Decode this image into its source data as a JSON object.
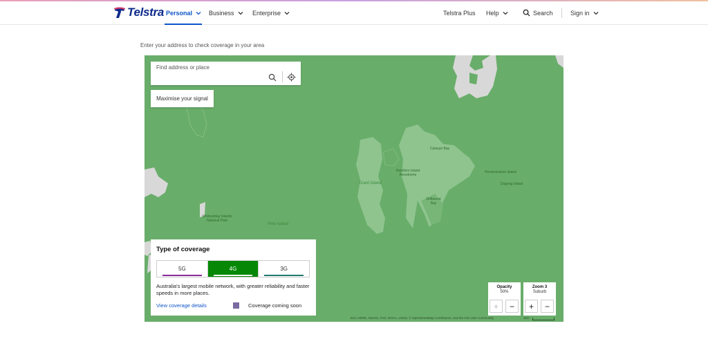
{
  "header": {
    "logo_text": "Telstra",
    "nav": [
      {
        "label": "Personal",
        "active": true
      },
      {
        "label": "Business",
        "active": false
      },
      {
        "label": "Enterprise",
        "active": false
      }
    ],
    "right": {
      "plus_label": "Telstra Plus",
      "help_label": "Help",
      "search_label": "Search",
      "signin_label": "Sign in"
    }
  },
  "intro": "Enter your address to check coverage in your area",
  "map": {
    "search_placeholder": "Find address or place",
    "maximise_label": "Maximise your signal",
    "labels": {
      "grant_island": "Grant Island",
      "pine_island": "Pine Island",
      "hamilton_island_aerodrome": "Hamilton Island Aerodrome",
      "catseye_bay": "Catseye Bay",
      "driftwood_bay": "Driftwood Bay",
      "perseverance_island": "Perseverance Island",
      "dugong_island": "Dugong Island",
      "national_park": "Whitsunday Islands National Park"
    },
    "attribution": "Esri, HERE, Garmin, FAO, NOAA, USGS, © OpenStreetMap contributors, and the GIS User Community",
    "scale_label": "1km",
    "colors": {
      "coverage_4g": "#69ad6a",
      "no_coverage": "#d6d6d6"
    }
  },
  "coverage_panel": {
    "title": "Type of coverage",
    "tabs": [
      {
        "label": "5G",
        "color": "#8a2a9a",
        "active": false
      },
      {
        "label": "4G",
        "color": "#068806",
        "active": true
      },
      {
        "label": "3G",
        "color": "#1f7a6a",
        "active": false
      }
    ],
    "description": "Australia's largest mobile network, with greater reliability and faster speeds in more places.",
    "link_label": "View coverage details",
    "legend_label": "Coverage coming soon",
    "legend_color": "#7a6aa0"
  },
  "controls": {
    "opacity": {
      "label": "Opacity",
      "value": "50%",
      "plus": "+",
      "minus": "−"
    },
    "zoom": {
      "label": "Zoom 3",
      "value": "Suburb",
      "plus": "+",
      "minus": "−"
    }
  }
}
